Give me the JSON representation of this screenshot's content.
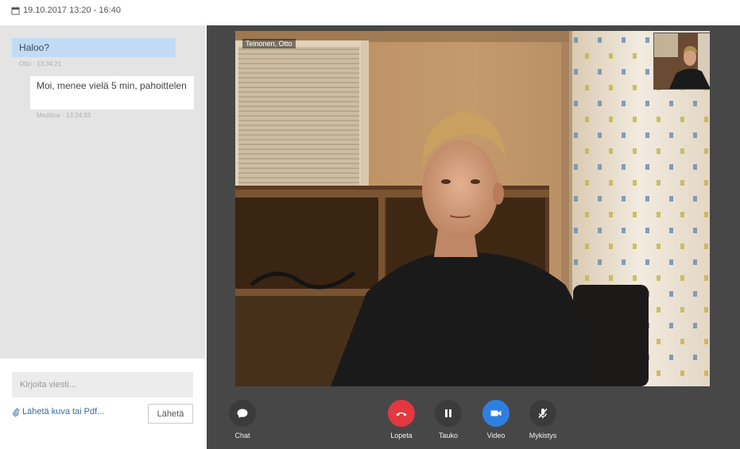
{
  "session": {
    "datetime": "19.10.2017 13:20 - 16:40"
  },
  "chat": {
    "messages": [
      {
        "sender": "Otto",
        "time": "13:34:21",
        "meta": "Otto · 13:34:21",
        "text": "Haloo?"
      },
      {
        "sender": "Mediline",
        "time": "13:34:33",
        "meta": "Mediline · 13:34:33",
        "text": "Moi, menee vielä 5 min, pahoittelen"
      }
    ],
    "compose_placeholder": "Kirjoita viesti...",
    "attach_label": "Lähetä kuva tai Pdf...",
    "send_label": "Lähetä"
  },
  "video": {
    "remote_name": "Teinonen, Otto"
  },
  "controls": {
    "chat": {
      "label": "Chat",
      "icon": "chat-bubble-icon",
      "color": "#3b3b3b"
    },
    "end": {
      "label": "Lopeta",
      "icon": "hangup-icon",
      "color": "#e2383f"
    },
    "pause": {
      "label": "Tauko",
      "icon": "pause-icon",
      "color": "#3b3b3b"
    },
    "video": {
      "label": "Video",
      "icon": "camera-icon",
      "color": "#2f7fe0"
    },
    "mute": {
      "label": "Mykistys",
      "icon": "mic-muted-icon",
      "color": "#3b3b3b"
    }
  }
}
